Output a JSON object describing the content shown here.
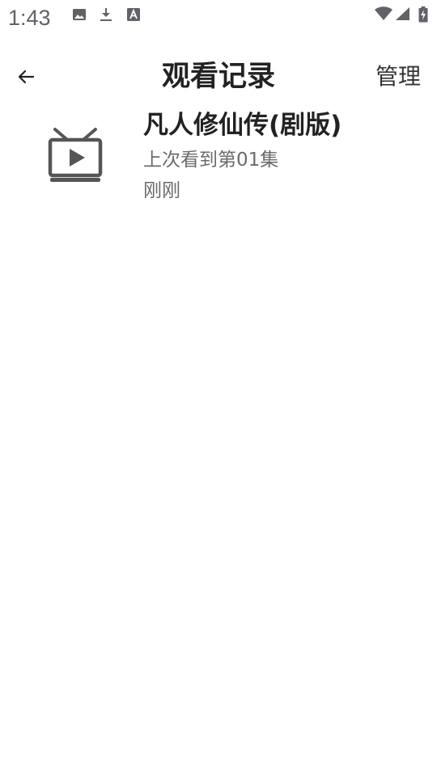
{
  "status_bar": {
    "time": "1:43",
    "left_icons": [
      "image-icon",
      "download-icon",
      "text-a-icon"
    ],
    "right_icons": [
      "wifi-icon",
      "cell-signal-icon",
      "battery-charging-icon"
    ]
  },
  "toolbar": {
    "back_icon": "arrow-left-icon",
    "title": "观看记录",
    "manage_label": "管理"
  },
  "history": {
    "items": [
      {
        "icon": "tv-play-icon",
        "title": "凡人修仙传(剧版)",
        "progress": "上次看到第01集",
        "time": "刚刚"
      }
    ]
  },
  "colors": {
    "background": "#ffffff",
    "title_text": "#222222",
    "secondary_text": "#6b6b6b",
    "icon": "#555555"
  }
}
